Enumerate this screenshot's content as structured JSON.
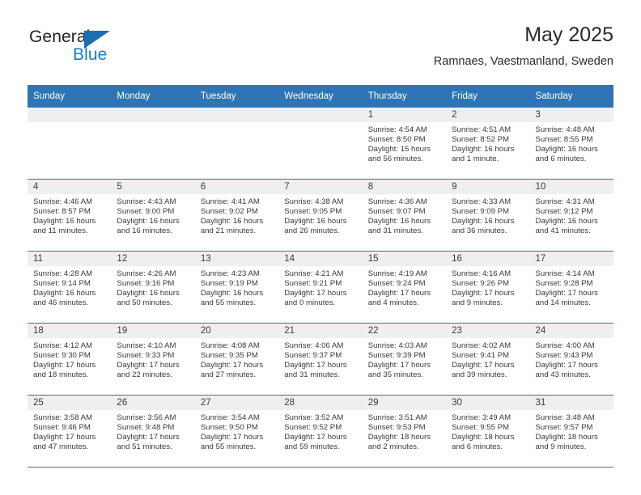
{
  "brand": {
    "name_part1": "General",
    "name_part2": "Blue",
    "logo_icon": "triangle-flag-icon",
    "accent_color": "#1a7bc4"
  },
  "header": {
    "title": "May 2025",
    "location": "Ramnaes, Vaestmanland, Sweden"
  },
  "theme": {
    "header_blue": "#2f75b5",
    "daynum_band": "#efefef",
    "text": "#3a3a3a"
  },
  "weekday_headers": [
    "Sunday",
    "Monday",
    "Tuesday",
    "Wednesday",
    "Thursday",
    "Friday",
    "Saturday"
  ],
  "weeks": [
    [
      {
        "day": "",
        "sunrise": "",
        "sunset": "",
        "daylight_line1": "",
        "daylight_line2": ""
      },
      {
        "day": "",
        "sunrise": "",
        "sunset": "",
        "daylight_line1": "",
        "daylight_line2": ""
      },
      {
        "day": "",
        "sunrise": "",
        "sunset": "",
        "daylight_line1": "",
        "daylight_line2": ""
      },
      {
        "day": "",
        "sunrise": "",
        "sunset": "",
        "daylight_line1": "",
        "daylight_line2": ""
      },
      {
        "day": "1",
        "sunrise": "Sunrise: 4:54 AM",
        "sunset": "Sunset: 8:50 PM",
        "daylight_line1": "Daylight: 15 hours",
        "daylight_line2": "and 56 minutes."
      },
      {
        "day": "2",
        "sunrise": "Sunrise: 4:51 AM",
        "sunset": "Sunset: 8:52 PM",
        "daylight_line1": "Daylight: 16 hours",
        "daylight_line2": "and 1 minute."
      },
      {
        "day": "3",
        "sunrise": "Sunrise: 4:48 AM",
        "sunset": "Sunset: 8:55 PM",
        "daylight_line1": "Daylight: 16 hours",
        "daylight_line2": "and 6 minutes."
      }
    ],
    [
      {
        "day": "4",
        "sunrise": "Sunrise: 4:46 AM",
        "sunset": "Sunset: 8:57 PM",
        "daylight_line1": "Daylight: 16 hours",
        "daylight_line2": "and 11 minutes."
      },
      {
        "day": "5",
        "sunrise": "Sunrise: 4:43 AM",
        "sunset": "Sunset: 9:00 PM",
        "daylight_line1": "Daylight: 16 hours",
        "daylight_line2": "and 16 minutes."
      },
      {
        "day": "6",
        "sunrise": "Sunrise: 4:41 AM",
        "sunset": "Sunset: 9:02 PM",
        "daylight_line1": "Daylight: 16 hours",
        "daylight_line2": "and 21 minutes."
      },
      {
        "day": "7",
        "sunrise": "Sunrise: 4:38 AM",
        "sunset": "Sunset: 9:05 PM",
        "daylight_line1": "Daylight: 16 hours",
        "daylight_line2": "and 26 minutes."
      },
      {
        "day": "8",
        "sunrise": "Sunrise: 4:36 AM",
        "sunset": "Sunset: 9:07 PM",
        "daylight_line1": "Daylight: 16 hours",
        "daylight_line2": "and 31 minutes."
      },
      {
        "day": "9",
        "sunrise": "Sunrise: 4:33 AM",
        "sunset": "Sunset: 9:09 PM",
        "daylight_line1": "Daylight: 16 hours",
        "daylight_line2": "and 36 minutes."
      },
      {
        "day": "10",
        "sunrise": "Sunrise: 4:31 AM",
        "sunset": "Sunset: 9:12 PM",
        "daylight_line1": "Daylight: 16 hours",
        "daylight_line2": "and 41 minutes."
      }
    ],
    [
      {
        "day": "11",
        "sunrise": "Sunrise: 4:28 AM",
        "sunset": "Sunset: 9:14 PM",
        "daylight_line1": "Daylight: 16 hours",
        "daylight_line2": "and 46 minutes."
      },
      {
        "day": "12",
        "sunrise": "Sunrise: 4:26 AM",
        "sunset": "Sunset: 9:16 PM",
        "daylight_line1": "Daylight: 16 hours",
        "daylight_line2": "and 50 minutes."
      },
      {
        "day": "13",
        "sunrise": "Sunrise: 4:23 AM",
        "sunset": "Sunset: 9:19 PM",
        "daylight_line1": "Daylight: 16 hours",
        "daylight_line2": "and 55 minutes."
      },
      {
        "day": "14",
        "sunrise": "Sunrise: 4:21 AM",
        "sunset": "Sunset: 9:21 PM",
        "daylight_line1": "Daylight: 17 hours",
        "daylight_line2": "and 0 minutes."
      },
      {
        "day": "15",
        "sunrise": "Sunrise: 4:19 AM",
        "sunset": "Sunset: 9:24 PM",
        "daylight_line1": "Daylight: 17 hours",
        "daylight_line2": "and 4 minutes."
      },
      {
        "day": "16",
        "sunrise": "Sunrise: 4:16 AM",
        "sunset": "Sunset: 9:26 PM",
        "daylight_line1": "Daylight: 17 hours",
        "daylight_line2": "and 9 minutes."
      },
      {
        "day": "17",
        "sunrise": "Sunrise: 4:14 AM",
        "sunset": "Sunset: 9:28 PM",
        "daylight_line1": "Daylight: 17 hours",
        "daylight_line2": "and 14 minutes."
      }
    ],
    [
      {
        "day": "18",
        "sunrise": "Sunrise: 4:12 AM",
        "sunset": "Sunset: 9:30 PM",
        "daylight_line1": "Daylight: 17 hours",
        "daylight_line2": "and 18 minutes."
      },
      {
        "day": "19",
        "sunrise": "Sunrise: 4:10 AM",
        "sunset": "Sunset: 9:33 PM",
        "daylight_line1": "Daylight: 17 hours",
        "daylight_line2": "and 22 minutes."
      },
      {
        "day": "20",
        "sunrise": "Sunrise: 4:08 AM",
        "sunset": "Sunset: 9:35 PM",
        "daylight_line1": "Daylight: 17 hours",
        "daylight_line2": "and 27 minutes."
      },
      {
        "day": "21",
        "sunrise": "Sunrise: 4:06 AM",
        "sunset": "Sunset: 9:37 PM",
        "daylight_line1": "Daylight: 17 hours",
        "daylight_line2": "and 31 minutes."
      },
      {
        "day": "22",
        "sunrise": "Sunrise: 4:03 AM",
        "sunset": "Sunset: 9:39 PM",
        "daylight_line1": "Daylight: 17 hours",
        "daylight_line2": "and 35 minutes."
      },
      {
        "day": "23",
        "sunrise": "Sunrise: 4:02 AM",
        "sunset": "Sunset: 9:41 PM",
        "daylight_line1": "Daylight: 17 hours",
        "daylight_line2": "and 39 minutes."
      },
      {
        "day": "24",
        "sunrise": "Sunrise: 4:00 AM",
        "sunset": "Sunset: 9:43 PM",
        "daylight_line1": "Daylight: 17 hours",
        "daylight_line2": "and 43 minutes."
      }
    ],
    [
      {
        "day": "25",
        "sunrise": "Sunrise: 3:58 AM",
        "sunset": "Sunset: 9:46 PM",
        "daylight_line1": "Daylight: 17 hours",
        "daylight_line2": "and 47 minutes."
      },
      {
        "day": "26",
        "sunrise": "Sunrise: 3:56 AM",
        "sunset": "Sunset: 9:48 PM",
        "daylight_line1": "Daylight: 17 hours",
        "daylight_line2": "and 51 minutes."
      },
      {
        "day": "27",
        "sunrise": "Sunrise: 3:54 AM",
        "sunset": "Sunset: 9:50 PM",
        "daylight_line1": "Daylight: 17 hours",
        "daylight_line2": "and 55 minutes."
      },
      {
        "day": "28",
        "sunrise": "Sunrise: 3:52 AM",
        "sunset": "Sunset: 9:52 PM",
        "daylight_line1": "Daylight: 17 hours",
        "daylight_line2": "and 59 minutes."
      },
      {
        "day": "29",
        "sunrise": "Sunrise: 3:51 AM",
        "sunset": "Sunset: 9:53 PM",
        "daylight_line1": "Daylight: 18 hours",
        "daylight_line2": "and 2 minutes."
      },
      {
        "day": "30",
        "sunrise": "Sunrise: 3:49 AM",
        "sunset": "Sunset: 9:55 PM",
        "daylight_line1": "Daylight: 18 hours",
        "daylight_line2": "and 6 minutes."
      },
      {
        "day": "31",
        "sunrise": "Sunrise: 3:48 AM",
        "sunset": "Sunset: 9:57 PM",
        "daylight_line1": "Daylight: 18 hours",
        "daylight_line2": "and 9 minutes."
      }
    ]
  ]
}
